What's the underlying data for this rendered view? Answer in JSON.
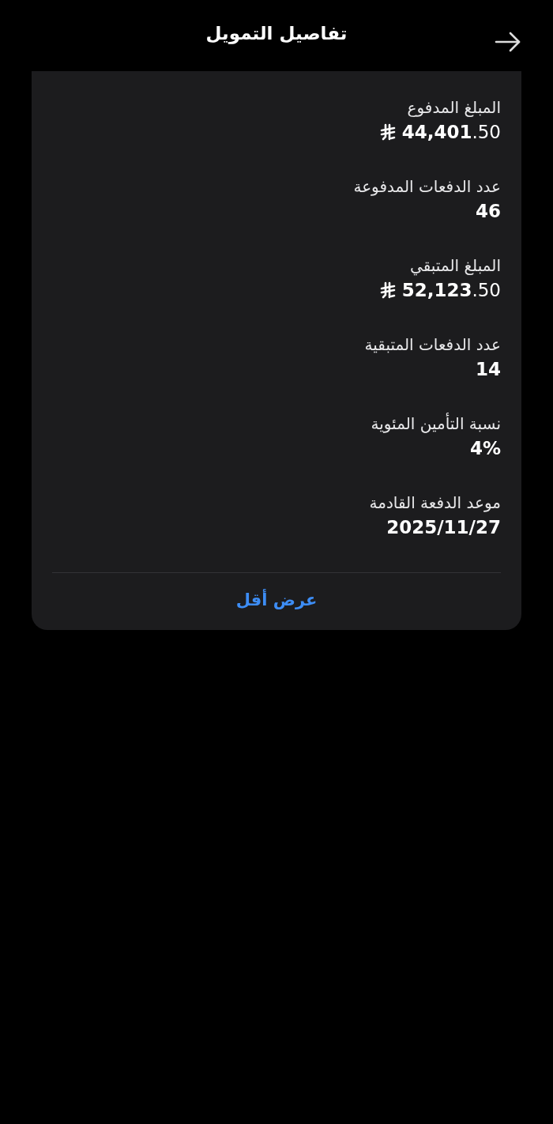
{
  "header": {
    "title": "تفاصيل التمويل"
  },
  "details": [
    {
      "label": "المبلغ المدفوع",
      "value": "**44,401**.50",
      "kind": "amount"
    },
    {
      "label": "عدد الدفعات المدفوعة",
      "value": "46",
      "kind": "plain"
    },
    {
      "label": "المبلغ المتبقي",
      "value": "**52,123**.50",
      "kind": "amount"
    },
    {
      "label": "عدد الدفعات المتبقية",
      "value": "14",
      "kind": "plain"
    },
    {
      "label": "نسبة التأمين المئوية",
      "value": "4%",
      "kind": "plain"
    },
    {
      "label": "موعد الدفعة القادمة",
      "value": "2025/11/27",
      "kind": "plain"
    }
  ],
  "footer_button": "عرض أقل"
}
